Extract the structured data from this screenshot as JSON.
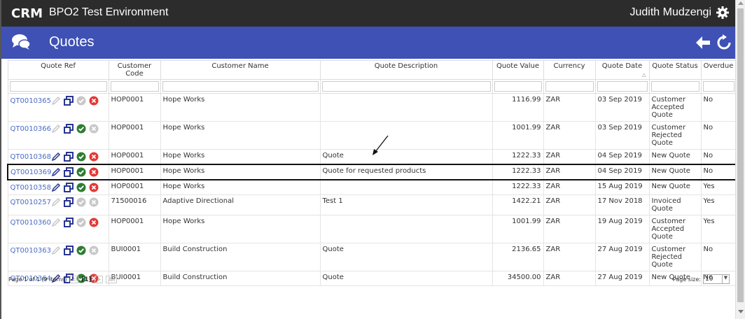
{
  "header": {
    "app_title": "BPO2 Test Environment",
    "user_name": "Judith Mudzengi"
  },
  "page": {
    "title": "Quotes"
  },
  "columns": [
    "Quote Ref",
    "Customer Code",
    "Customer Name",
    "Quote Description",
    "Quote Value",
    "Currency",
    "Quote Date",
    "Quote Status",
    "Overdue"
  ],
  "rows": [
    {
      "ref": "QT0010365",
      "code": "HOP0001",
      "name": "Hope Works",
      "desc": "",
      "value": "1116.99",
      "currency": "ZAR",
      "date": "03 Sep 2019",
      "status": "Customer Accepted Quote",
      "overdue": "No",
      "edit": false,
      "accept": false,
      "reject": true,
      "highlight": false
    },
    {
      "ref": "QT0010366",
      "code": "HOP0001",
      "name": "Hope Works",
      "desc": "",
      "value": "1001.99",
      "currency": "ZAR",
      "date": "03 Sep 2019",
      "status": "Customer Rejected Quote",
      "overdue": "No",
      "edit": false,
      "accept": true,
      "reject": false,
      "highlight": false
    },
    {
      "ref": "QT0010368",
      "code": "HOP0001",
      "name": "Hope Works",
      "desc": "Quote",
      "value": "1222.33",
      "currency": "ZAR",
      "date": "04 Sep 2019",
      "status": "New Quote",
      "overdue": "No",
      "edit": true,
      "accept": true,
      "reject": true,
      "highlight": false
    },
    {
      "ref": "QT0010369",
      "code": "HOP0001",
      "name": "Hope Works",
      "desc": "Quote for requested products",
      "value": "1222.33",
      "currency": "ZAR",
      "date": "04 Sep 2019",
      "status": "New Quote",
      "overdue": "No",
      "edit": true,
      "accept": true,
      "reject": true,
      "highlight": true
    },
    {
      "ref": "QT0010358",
      "code": "HOP0001",
      "name": "Hope Works",
      "desc": "",
      "value": "1222.33",
      "currency": "ZAR",
      "date": "15 Aug 2019",
      "status": "New Quote",
      "overdue": "Yes",
      "edit": true,
      "accept": true,
      "reject": true,
      "highlight": false
    },
    {
      "ref": "QT0010257",
      "code": "71500016",
      "name": "Adaptive Directional",
      "desc": "Test 1",
      "value": "1422.21",
      "currency": "ZAR",
      "date": "17 Nov 2018",
      "status": "Invoiced Quote",
      "overdue": "Yes",
      "edit": false,
      "accept": false,
      "reject": false,
      "highlight": false
    },
    {
      "ref": "QT0010360",
      "code": "HOP0001",
      "name": "Hope Works",
      "desc": "",
      "value": "1001.99",
      "currency": "ZAR",
      "date": "19 Aug 2019",
      "status": "Customer Accepted Quote",
      "overdue": "Yes",
      "edit": false,
      "accept": false,
      "reject": true,
      "highlight": false
    },
    {
      "ref": "QT0010363",
      "code": "BUI0001",
      "name": "Build Construction",
      "desc": "Quote",
      "value": "2136.65",
      "currency": "ZAR",
      "date": "27 Aug 2019",
      "status": "Customer Rejected Quote",
      "overdue": "No",
      "edit": false,
      "accept": true,
      "reject": false,
      "highlight": false
    },
    {
      "ref": "QT0010364",
      "code": "BUI0001",
      "name": "Build Construction",
      "desc": "Quote",
      "value": "34500.00",
      "currency": "ZAR",
      "date": "27 Aug 2019",
      "status": "New Quote",
      "overdue": "No",
      "edit": true,
      "accept": true,
      "reject": true,
      "highlight": false
    }
  ],
  "pager": {
    "summary": "Page 1 of 1 (9 items)",
    "prev": "<",
    "current": "[1]",
    "next": ">",
    "all": "All",
    "page_size_label": "Page size:",
    "page_size_value": "10"
  },
  "colors": {
    "topbar": "#2c2c2c",
    "titlebar": "#3f51b5",
    "link": "#4a6cc7",
    "accept_active": "#2e7d32",
    "reject_active": "#e53935",
    "edit_active": "#283593",
    "inactive": "#c8c8c8"
  }
}
